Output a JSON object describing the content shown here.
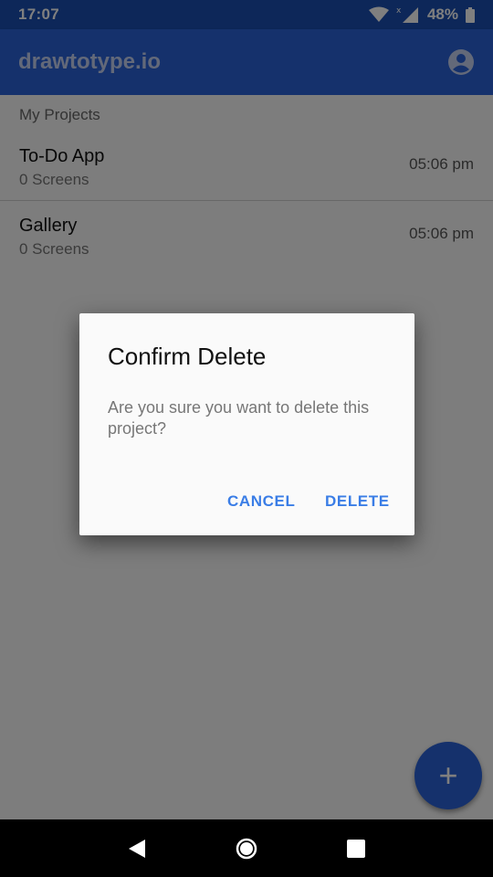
{
  "status_bar": {
    "time": "17:07",
    "battery": "48%"
  },
  "app_bar": {
    "title": "drawtotype.io",
    "account_icon": "account-circle-icon"
  },
  "list": {
    "header": "My Projects",
    "projects": [
      {
        "name": "To-Do App",
        "screens": "0 Screens",
        "time": "05:06 pm"
      },
      {
        "name": "Gallery",
        "screens": "0 Screens",
        "time": "05:06 pm"
      }
    ]
  },
  "fab": {
    "label": "+"
  },
  "dialog": {
    "title": "Confirm Delete",
    "message": "Are you sure you want to delete this project?",
    "cancel": "CANCEL",
    "delete": "DELETE"
  },
  "colors": {
    "primary": "#2b63d9",
    "status": "#1b4fb3",
    "accent": "#3a7de6"
  }
}
